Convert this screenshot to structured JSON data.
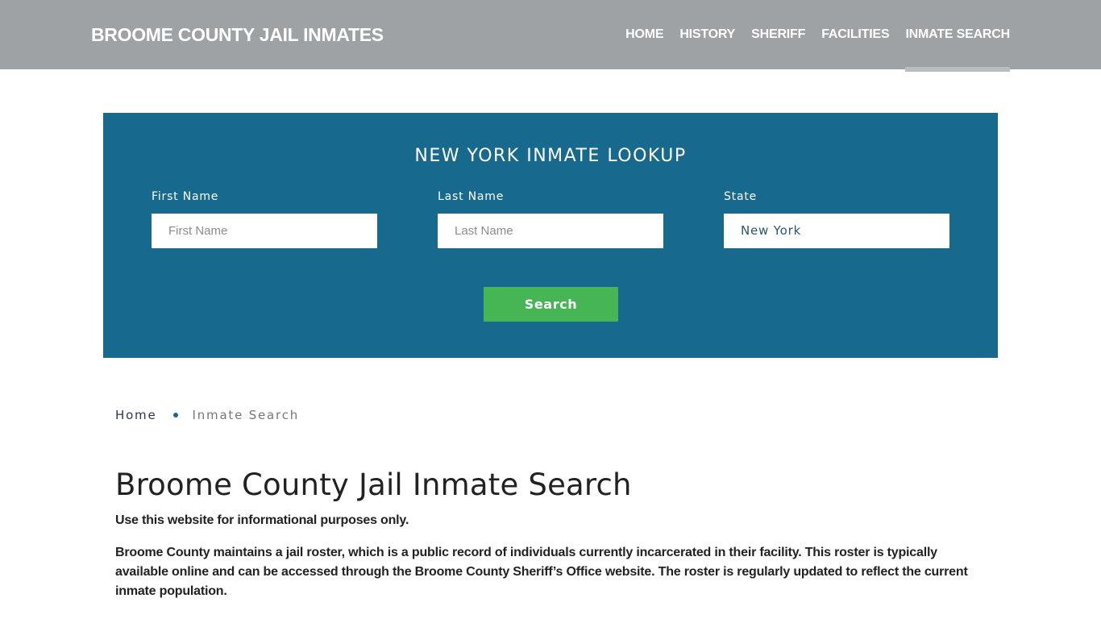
{
  "header": {
    "brand": "BROOME COUNTY JAIL INMATES",
    "nav": [
      {
        "label": "HOME",
        "active": false
      },
      {
        "label": "HISTORY",
        "active": false
      },
      {
        "label": "SHERIFF",
        "active": false
      },
      {
        "label": "FACILITIES",
        "active": false
      },
      {
        "label": "INMATE SEARCH",
        "active": true
      }
    ]
  },
  "lookup": {
    "title": "NEW YORK INMATE LOOKUP",
    "first_name": {
      "label": "First Name",
      "placeholder": "First Name",
      "value": ""
    },
    "last_name": {
      "label": "Last Name",
      "placeholder": "Last Name",
      "value": ""
    },
    "state": {
      "label": "State",
      "value": "New York"
    },
    "search_label": "Search"
  },
  "breadcrumb": {
    "home": "Home",
    "current": "Inmate Search"
  },
  "content": {
    "title": "Broome County Jail Inmate Search",
    "paragraphs": [
      "Use this website for informational purposes only.",
      "Broome County maintains a jail roster, which is a public record of individuals currently incarcerated in their facility. This roster is typically available online and can be accessed through the Broome County Sheriff’s Office website. The roster is regularly updated to reflect the current inmate population."
    ]
  },
  "colors": {
    "header_bg": "#9ea2a5",
    "lookup_bg": "#176a8e",
    "search_button": "#46b655",
    "active_underline": "#b9bcbd"
  }
}
